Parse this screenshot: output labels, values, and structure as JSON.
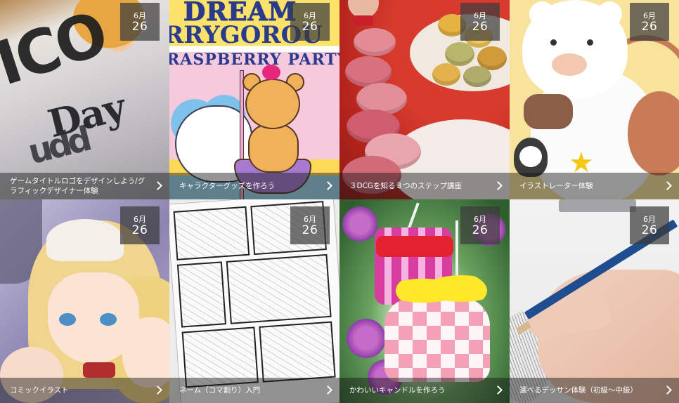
{
  "tiles": [
    {
      "month": "6月",
      "day": "26",
      "title": "ゲームタイトルロゴをデザインしよう/グラフィックデザイナー体験",
      "art_text": [
        "ICO",
        "Day",
        "udd"
      ]
    },
    {
      "month": "6月",
      "day": "26",
      "title": "キャラクターグッズを作ろう",
      "art_text": [
        "DREAM",
        "RRYGOROU",
        "RASPBERRY PARTY"
      ]
    },
    {
      "month": "6月",
      "day": "26",
      "title": "３DCGを知る３つのステップ講座"
    },
    {
      "month": "6月",
      "day": "26",
      "title": "イラストレーター体験"
    },
    {
      "month": "6月",
      "day": "26",
      "title": "コミックイラスト"
    },
    {
      "month": "6月",
      "day": "26",
      "title": "ネーム（コマ割り）入門"
    },
    {
      "month": "6月",
      "day": "26",
      "title": "かわいいキャンドルを作ろう"
    },
    {
      "month": "6月",
      "day": "26",
      "title": "選べるデッサン体験（初級～中級）"
    }
  ],
  "icons": {
    "caption_arrow": "chevron-right-icon"
  },
  "colors": {
    "date_badge_bg": "#3c3c3c",
    "caption_bg": "#141414",
    "text": "#ffffff"
  }
}
